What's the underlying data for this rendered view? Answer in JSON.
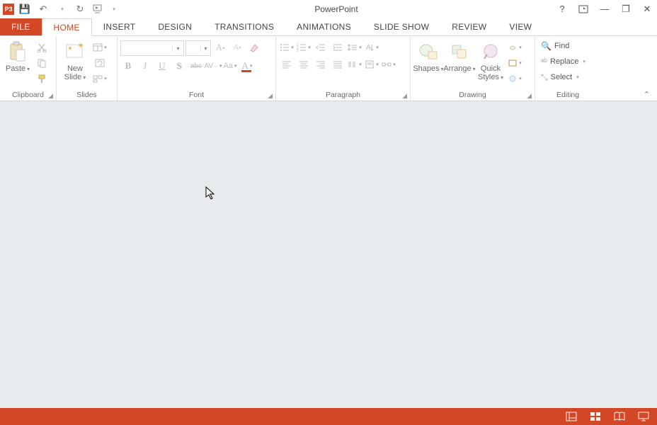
{
  "title": "PowerPoint",
  "qat": {
    "app": "P3",
    "save": "💾",
    "undo": "↶",
    "redo": "↻",
    "start": "⏵"
  },
  "wincontrols": {
    "help": "?",
    "opts": "▭",
    "min": "—",
    "restore": "❐",
    "close": "✕"
  },
  "tabs": {
    "file": "FILE",
    "home": "HOME",
    "insert": "INSERT",
    "design": "DESIGN",
    "transitions": "TRANSITIONS",
    "animations": "ANIMATIONS",
    "slideshow": "SLIDE SHOW",
    "review": "REVIEW",
    "view": "VIEW"
  },
  "groups": {
    "clipboard": {
      "label": "Clipboard",
      "paste": "Paste"
    },
    "slides": {
      "label": "Slides",
      "newslide_l1": "New",
      "newslide_l2": "Slide"
    },
    "font": {
      "label": "Font",
      "font_name": "",
      "font_size": ""
    },
    "paragraph": {
      "label": "Paragraph"
    },
    "drawing": {
      "label": "Drawing",
      "shapes": "Shapes",
      "arrange": "Arrange",
      "quick_l1": "Quick",
      "quick_l2": "Styles"
    },
    "editing": {
      "label": "Editing",
      "find": "Find",
      "replace": "Replace",
      "select": "Select"
    }
  }
}
